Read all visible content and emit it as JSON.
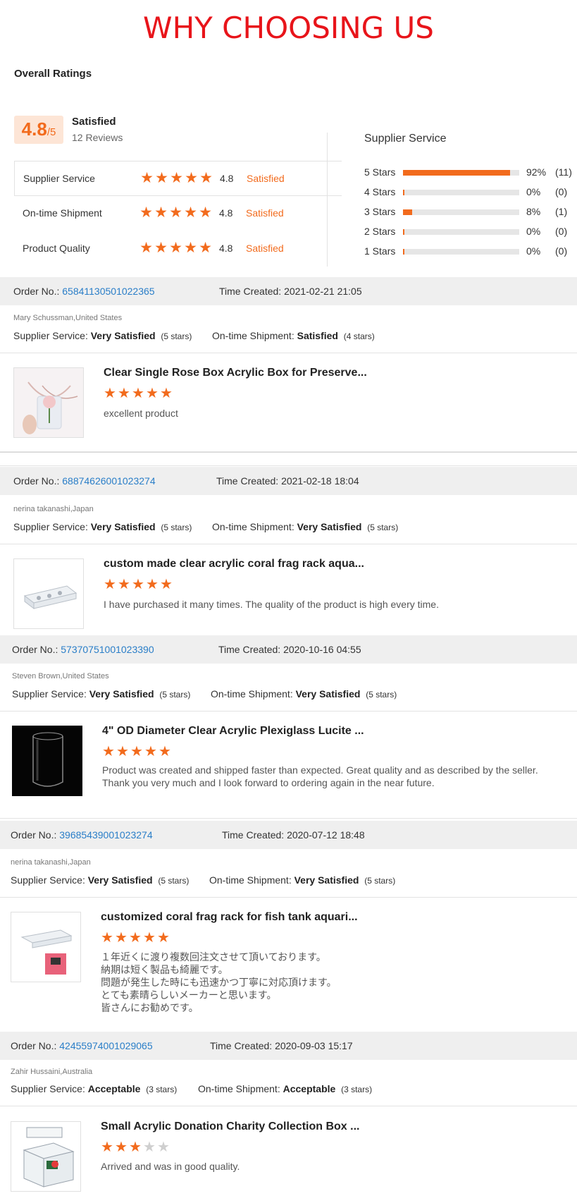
{
  "banner": {
    "title": "WHY CHOOSING US"
  },
  "overall": {
    "title": "Overall Ratings",
    "score": "4.8",
    "score_max": "/5",
    "label": "Satisfied",
    "reviews": "12 Reviews",
    "rows": [
      {
        "label": "Supplier Service",
        "value": "4.8",
        "word": "Satisfied",
        "stars": 4.8
      },
      {
        "label": "On-time Shipment",
        "value": "4.8",
        "word": "Satisfied",
        "stars": 4.8
      },
      {
        "label": "Product Quality",
        "value": "4.8",
        "word": "Satisfied",
        "stars": 4.8
      }
    ]
  },
  "distribution": {
    "title": "Supplier Service",
    "rows": [
      {
        "label": "5 Stars",
        "pct": "92%",
        "count": "(11)",
        "fraction": 0.92
      },
      {
        "label": "4 Stars",
        "pct": "0%",
        "count": "(0)",
        "fraction": 0.0
      },
      {
        "label": "3 Stars",
        "pct": "8%",
        "count": "(1)",
        "fraction": 0.08
      },
      {
        "label": "2 Stars",
        "pct": "0%",
        "count": "(0)",
        "fraction": 0.0
      },
      {
        "label": "1 Stars",
        "pct": "0%",
        "count": "(0)",
        "fraction": 0.0
      }
    ]
  },
  "labels": {
    "order_no": "Order No.:",
    "time_created": "Time Created:",
    "supplier_service": "Supplier Service:",
    "ontime_shipment": "On-time Shipment:"
  },
  "orders": [
    {
      "order_no": "65841130501022365",
      "time": "2021-02-21 21:05",
      "buyer": "Mary Schussman,United States",
      "supplier_rating": "Very Satisfied",
      "supplier_stars": "(5 stars)",
      "shipment_rating": "Satisfied",
      "shipment_stars": "(4 stars)",
      "product": "Clear Single Rose Box Acrylic Box for Preserve...",
      "rating": 5,
      "review": "excellent product"
    },
    {
      "order_no": "68874626001023274",
      "time": "2021-02-18 18:04",
      "buyer": "nerina takanashi,Japan",
      "supplier_rating": "Very Satisfied",
      "supplier_stars": "(5 stars)",
      "shipment_rating": "Very Satisfied",
      "shipment_stars": "(5 stars)",
      "product": "custom made clear acrylic coral frag rack aqua...",
      "rating": 5,
      "review": "I have purchased it many times. The quality of the product is high every time."
    },
    {
      "order_no": "57370751001023390",
      "time": "2020-10-16 04:55",
      "buyer": "Steven Brown,United States",
      "supplier_rating": "Very Satisfied",
      "supplier_stars": "(5 stars)",
      "shipment_rating": "Very Satisfied",
      "shipment_stars": "(5 stars)",
      "product": "4\" OD Diameter Clear Acrylic Plexiglass Lucite ...",
      "rating": 5,
      "review": "Product was created and shipped faster than expected. Great quality and as described by the seller. Thank you very much and I look forward to ordering again in the near future."
    },
    {
      "order_no": "39685439001023274",
      "time": "2020-07-12 18:48",
      "buyer": "nerina takanashi,Japan",
      "supplier_rating": "Very Satisfied",
      "supplier_stars": "(5 stars)",
      "shipment_rating": "Very Satisfied",
      "shipment_stars": "(5 stars)",
      "product": "customized coral frag rack for fish tank aquari...",
      "rating": 5,
      "review": "１年近くに渡り複数回注文させて頂いております。\n納期は短く製品も綺麗です。\n問題が発生した時にも迅速かつ丁寧に対応頂けます。\nとても素晴らしいメーカーと思います。\n皆さんにお勧めです。"
    },
    {
      "order_no": "42455974001029065",
      "time": "2020-09-03 15:17",
      "buyer": "Zahir Hussaini,Australia",
      "supplier_rating": "Acceptable",
      "supplier_stars": "(3 stars)",
      "shipment_rating": "Acceptable",
      "shipment_stars": "(3 stars)",
      "product": "Small Acrylic Donation Charity Collection Box ...",
      "rating": 3,
      "review": "Arrived and was in good quality."
    }
  ],
  "colors": {
    "accent": "#f26b1d",
    "link": "#2a7ec8",
    "banner": "#e8141a"
  }
}
